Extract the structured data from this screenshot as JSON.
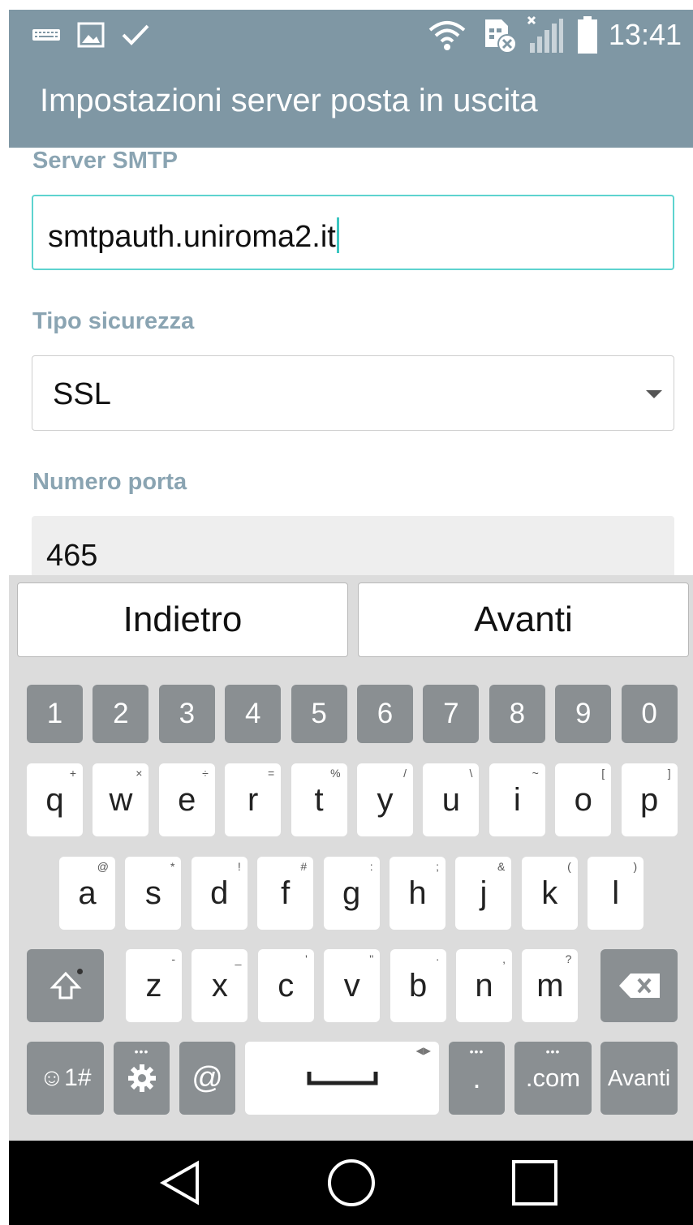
{
  "status_bar": {
    "time": "13:41",
    "left_icons": [
      "keyboard-icon",
      "image-icon",
      "check-icon"
    ],
    "right_icons": [
      "wifi-icon",
      "sim-error-icon",
      "signal-icon",
      "battery-icon"
    ]
  },
  "app_bar": {
    "title": "Impostazioni server posta in uscita"
  },
  "form": {
    "smtp": {
      "label": "Server SMTP",
      "value": "smtpauth.uniroma2.it"
    },
    "security": {
      "label": "Tipo sicurezza",
      "value": "SSL"
    },
    "port": {
      "label": "Numero porta",
      "value": "465"
    }
  },
  "keyboard": {
    "back_label": "Indietro",
    "next_label": "Avanti",
    "numbers": [
      "1",
      "2",
      "3",
      "4",
      "5",
      "6",
      "7",
      "8",
      "9",
      "0"
    ],
    "row1": [
      {
        "k": "q",
        "s": "+"
      },
      {
        "k": "w",
        "s": "×"
      },
      {
        "k": "e",
        "s": "÷"
      },
      {
        "k": "r",
        "s": "="
      },
      {
        "k": "t",
        "s": "%"
      },
      {
        "k": "y",
        "s": "/"
      },
      {
        "k": "u",
        "s": "\\"
      },
      {
        "k": "i",
        "s": "~"
      },
      {
        "k": "o",
        "s": "["
      },
      {
        "k": "p",
        "s": "]"
      }
    ],
    "row2": [
      {
        "k": "a",
        "s": "@"
      },
      {
        "k": "s",
        "s": "*"
      },
      {
        "k": "d",
        "s": "!"
      },
      {
        "k": "f",
        "s": "#"
      },
      {
        "k": "g",
        "s": ":"
      },
      {
        "k": "h",
        "s": ";"
      },
      {
        "k": "j",
        "s": "&"
      },
      {
        "k": "k",
        "s": "("
      },
      {
        "k": "l",
        "s": ")"
      }
    ],
    "row3": [
      {
        "k": "z",
        "s": "-"
      },
      {
        "k": "x",
        "s": "_"
      },
      {
        "k": "c",
        "s": "'"
      },
      {
        "k": "v",
        "s": "\""
      },
      {
        "k": "b",
        "s": "·"
      },
      {
        "k": "n",
        "s": ","
      },
      {
        "k": "m",
        "s": "?"
      }
    ],
    "symbols_label": "☺1#",
    "at_label": "@",
    "period_label": ".",
    "com_label": ".com",
    "enter_label": "Avanti"
  }
}
